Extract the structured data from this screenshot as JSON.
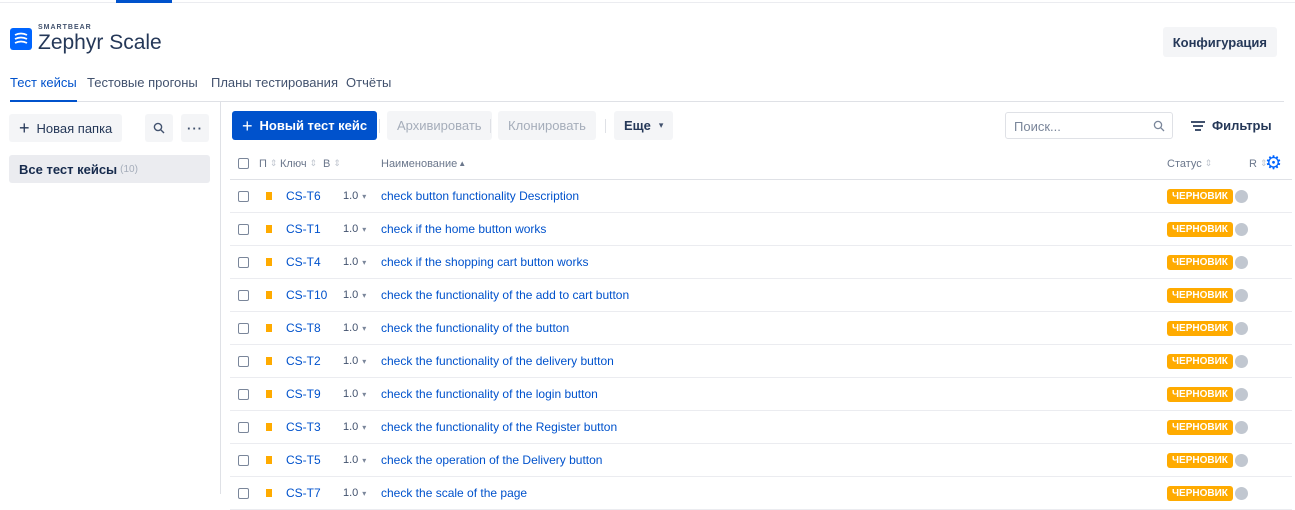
{
  "header": {
    "brand": "SMARTBEAR",
    "product": "Zephyr Scale",
    "config_label": "Конфигурация"
  },
  "tabs": [
    {
      "label": "Тест кейсы",
      "active": true
    },
    {
      "label": "Тестовые прогоны",
      "active": false
    },
    {
      "label": "Планы тестирования",
      "active": false
    },
    {
      "label": "Отчёты",
      "active": false
    }
  ],
  "sidebar": {
    "new_folder_label": "Новая папка",
    "search_icon": "search-icon",
    "more_icon": "ellipsis-icon",
    "all_cases_label": "Все тест кейсы",
    "all_cases_count": "(10)"
  },
  "toolbar": {
    "new_case_label": "Новый тест кейс",
    "archive_label": "Архивировать",
    "clone_label": "Клонировать",
    "more_label": "Еще",
    "search_placeholder": "Поиск...",
    "filters_label": "Фильтры"
  },
  "table": {
    "columns": {
      "priority": "П",
      "key": "Ключ",
      "version": "В",
      "name": "Наименование",
      "status": "Статус",
      "r": "R"
    },
    "rows": [
      {
        "key": "CS-T6",
        "version": "1.0",
        "name": "check button functionality Description",
        "status": "ЧЕРНОВИК"
      },
      {
        "key": "CS-T1",
        "version": "1.0",
        "name": "check if the home button works",
        "status": "ЧЕРНОВИК"
      },
      {
        "key": "CS-T4",
        "version": "1.0",
        "name": "check if the shopping cart button works",
        "status": "ЧЕРНОВИК"
      },
      {
        "key": "CS-T10",
        "version": "1.0",
        "name": "check the functionality of the add to cart button",
        "status": "ЧЕРНОВИК"
      },
      {
        "key": "CS-T8",
        "version": "1.0",
        "name": "check the functionality of the button",
        "status": "ЧЕРНОВИК"
      },
      {
        "key": "CS-T2",
        "version": "1.0",
        "name": "check the functionality of the delivery button",
        "status": "ЧЕРНОВИК"
      },
      {
        "key": "CS-T9",
        "version": "1.0",
        "name": "check the functionality of the login button",
        "status": "ЧЕРНОВИК"
      },
      {
        "key": "CS-T3",
        "version": "1.0",
        "name": "check the functionality of the Register button",
        "status": "ЧЕРНОВИК"
      },
      {
        "key": "CS-T5",
        "version": "1.0",
        "name": "check the operation of the Delivery button",
        "status": "ЧЕРНОВИК"
      },
      {
        "key": "CS-T7",
        "version": "1.0",
        "name": "check the scale of the page",
        "status": "ЧЕРНОВИК"
      }
    ]
  },
  "colors": {
    "primary": "#0052cc",
    "draft_status": "#ffab00",
    "flag": "#ffab00"
  }
}
